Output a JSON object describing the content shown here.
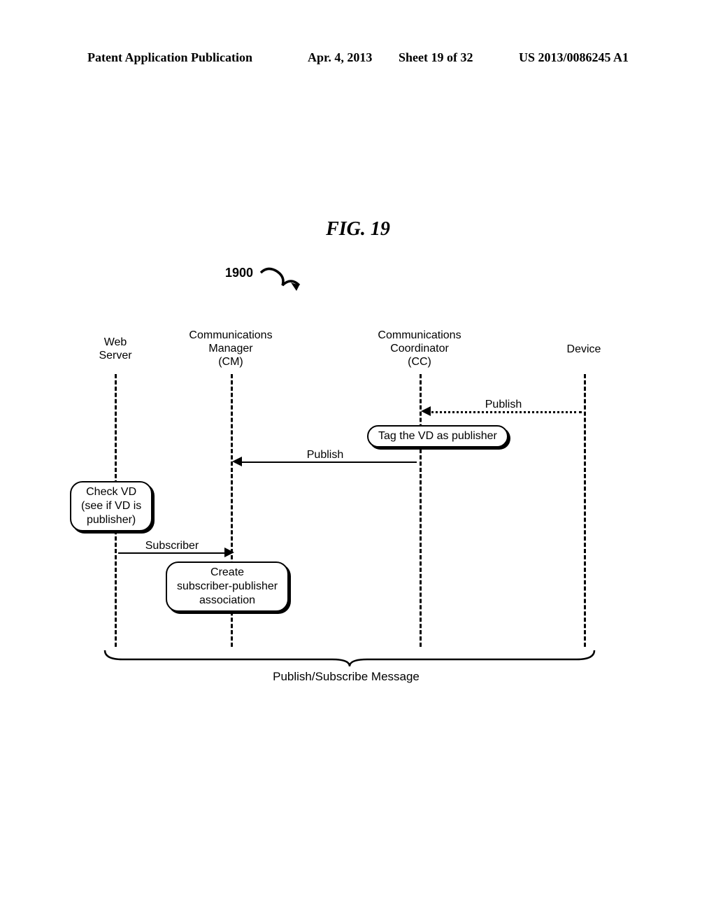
{
  "header": {
    "left": "Patent Application Publication",
    "date": "Apr. 4, 2013",
    "sheet": "Sheet 19 of 32",
    "right": "US 2013/0086245 A1"
  },
  "figure": {
    "title": "FIG. 19",
    "ref": "1900"
  },
  "lifelines": {
    "web": "Web\nServer",
    "cm": "Communications\nManager\n(CM)",
    "cc": "Communications\nCoordinator\n(CC)",
    "device": "Device"
  },
  "messages": {
    "publish1": "Publish",
    "publish2": "Publish",
    "subscriber": "Subscriber"
  },
  "notes": {
    "tag": "Tag the VD as publisher",
    "check": "Check VD\n(see if VD is\npublisher)",
    "create": "Create\nsubscriber-publisher\nassociation"
  },
  "brace_label": "Publish/Subscribe Message"
}
